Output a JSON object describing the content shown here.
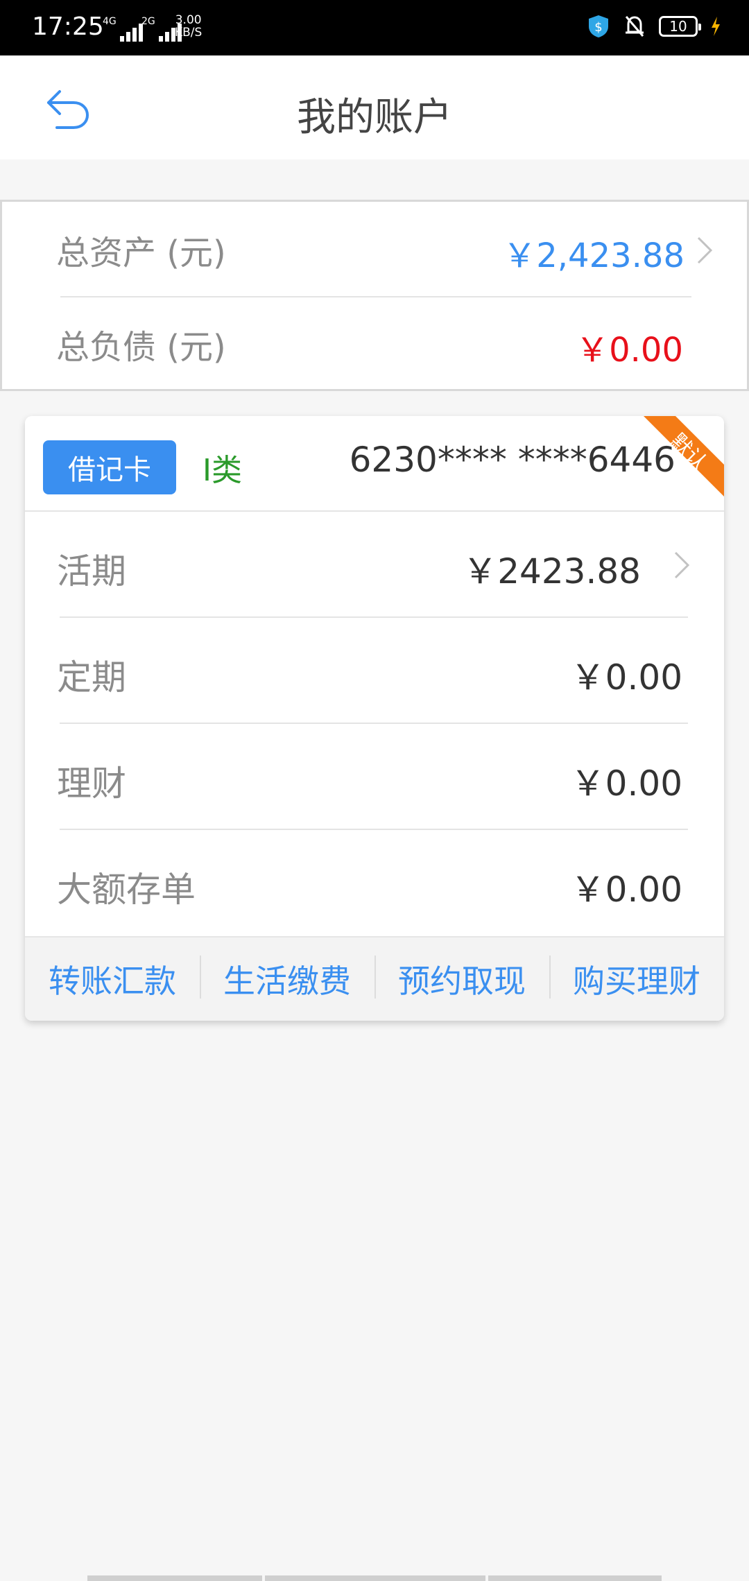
{
  "status_bar": {
    "time": "17:25",
    "net1": "4G",
    "net2": "2G",
    "speed_value": "3.00",
    "speed_unit": "KB/S",
    "battery": "10"
  },
  "header": {
    "title": "我的账户",
    "back_icon": "back-arrow-icon"
  },
  "summary": {
    "total_assets_label": "总资产 (元)",
    "total_assets_value": "￥2,423.88",
    "total_liabilities_label": "总负债 (元)",
    "total_liabilities_value": "￥0.00"
  },
  "card": {
    "type_label": "借记卡",
    "class_label": "I类",
    "number": "6230**** ****6446",
    "default_badge": "默认",
    "rows": [
      {
        "label": "活期",
        "value": "￥2423.88"
      },
      {
        "label": "定期",
        "value": "￥0.00"
      },
      {
        "label": "理财",
        "value": "￥0.00"
      },
      {
        "label": "大额存单",
        "value": "￥0.00"
      }
    ],
    "actions": [
      "转账汇款",
      "生活缴费",
      "预约取现",
      "购买理财"
    ]
  },
  "colors": {
    "accent": "#3a8ff0",
    "liability": "#e8101a",
    "class_green": "#2a9a2a",
    "ribbon": "#f47b16"
  }
}
